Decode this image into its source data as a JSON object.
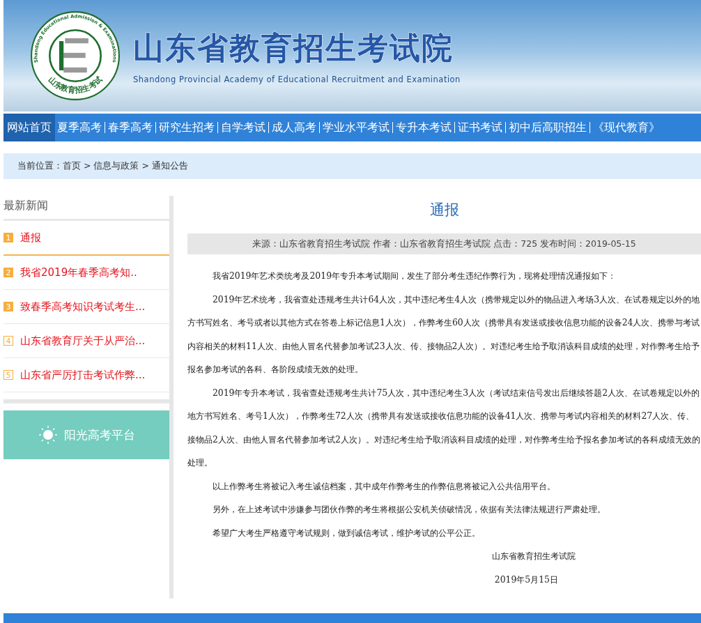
{
  "header": {
    "logo": {
      "ring_text": "Shandong Educational Admission & Examinations",
      "bottom_text": "山东教育招生考试"
    },
    "title": "山东省教育招生考试院",
    "subtitle": "Shandong Provincial Academy of Educational Recruitment and Examination"
  },
  "nav": [
    {
      "label": "网站首页",
      "selected": true
    },
    {
      "label": "夏季高考",
      "selected": false
    },
    {
      "label": "春季高考",
      "selected": false
    },
    {
      "label": "研究生招考",
      "selected": false
    },
    {
      "label": "自学考试",
      "selected": false
    },
    {
      "label": "成人高考",
      "selected": false
    },
    {
      "label": "学业水平考试",
      "selected": false
    },
    {
      "label": "专升本考试",
      "selected": false
    },
    {
      "label": "证书考试",
      "selected": false
    },
    {
      "label": "初中后高职招生",
      "selected": false
    },
    {
      "label": "《现代教育》",
      "selected": false
    }
  ],
  "breadcrumb": "当前位置：首页 > 信息与政策 > 通知公告",
  "sidebar": {
    "title": "最新新闻",
    "items": [
      {
        "rank": "1",
        "label": "通报",
        "highlighted": true,
        "selected": true
      },
      {
        "rank": "2",
        "label": "我省2019年春季高考知..",
        "highlighted": true,
        "selected": false
      },
      {
        "rank": "3",
        "label": "致春季高考知识考试考生...",
        "highlighted": true,
        "selected": false
      },
      {
        "rank": "4",
        "label": "山东省教育厅关于从严治...",
        "highlighted": false,
        "selected": false
      },
      {
        "rank": "5",
        "label": "山东省严厉打击考试作弊...",
        "highlighted": false,
        "selected": false
      }
    ],
    "platform_button": "阳光高考平台"
  },
  "article": {
    "title": "通报",
    "meta": "来源：山东省教育招生考试院 作者：山东省教育招生考试院 点击：725 发布时间：2019-05-15",
    "paragraphs": [
      "我省2019年艺术类统考及2019年专升本考试期间，发生了部分考生违纪作弊行为，现将处理情况通报如下：",
      "2019年艺术统考，我省查处违规考生共计64人次，其中违纪考生4人次（携带规定以外的物品进入考场3人次、在试卷规定以外的地方书写姓名、考号或者以其他方式在答卷上标记信息1人次），作弊考生60人次（携带具有发送或接收信息功能的设备24人次、携带与考试内容相关的材料11人次、由他人冒名代替参加考试23人次、传、接物品2人次）。对违纪考生给予取消该科目成绩的处理，对作弊考生给予报名参加考试的各科、各阶段成绩无效的处理。",
      "2019年专升本考试，我省查处违规考生共计75人次，其中违纪考生3人次（考试结束信号发出后继续答题2人次、在试卷规定以外的地方书写姓名、考号1人次），作弊考生72人次（携带具有发送或接收信息功能的设备41人次、携带与考试内容相关的材料27人次、传、接物品2人次、由他人冒名代替参加考试2人次）。对违纪考生给予取消该科目成绩的处理，对作弊考生给予报名参加考试的各科成绩无效的处理。",
      "以上作弊考生将被记入考生诚信档案，其中成年作弊考生的作弊信息将被记入公共信用平台。",
      "另外，在上述考试中涉嫌参与团伙作弊的考生将根据公安机关侦破情况，依据有关法律法规进行严肃处理。",
      "希望广大考生严格遵守考试规则，做到诚信考试，维护考试的公平公正。"
    ],
    "signature": "山东省教育招生考试院",
    "date": "2019年5月15日"
  }
}
